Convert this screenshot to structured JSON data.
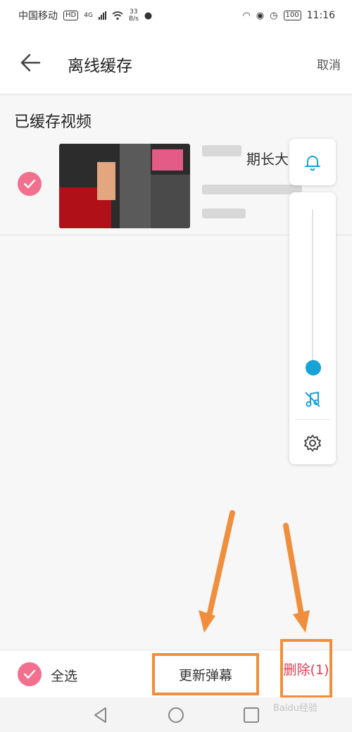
{
  "status_bar": {
    "carrier": "中国移动",
    "hd_badge": "HD",
    "network": "4G",
    "speed_value": "33",
    "speed_unit": "B/s",
    "battery": "100",
    "time": "11:16"
  },
  "header": {
    "title": "离线缓存",
    "cancel_label": "取消",
    "back_icon": "back-arrow-icon"
  },
  "section": {
    "title": "已缓存视频"
  },
  "video": {
    "title_partial": "期长大",
    "selected": true
  },
  "floating_panel": {
    "bell_icon": "bell-icon",
    "slider_level": 0.0,
    "mute_icon": "music-off-icon",
    "settings_icon": "gear-icon"
  },
  "bottom_bar": {
    "select_all_label": "全选",
    "update_button_label": "更新弹幕",
    "delete_button_label": "删除(1)"
  },
  "nav_bar": {
    "back_icon": "triangle-back-icon",
    "home_icon": "circle-home-icon",
    "recents_icon": "square-recents-icon"
  },
  "watermark": "Baidu经验",
  "colors": {
    "accent_pink": "#f26f8e",
    "accent_blue": "#16a3d8",
    "delete_red": "#e53950",
    "annotation_orange": "#ef8f3d"
  }
}
